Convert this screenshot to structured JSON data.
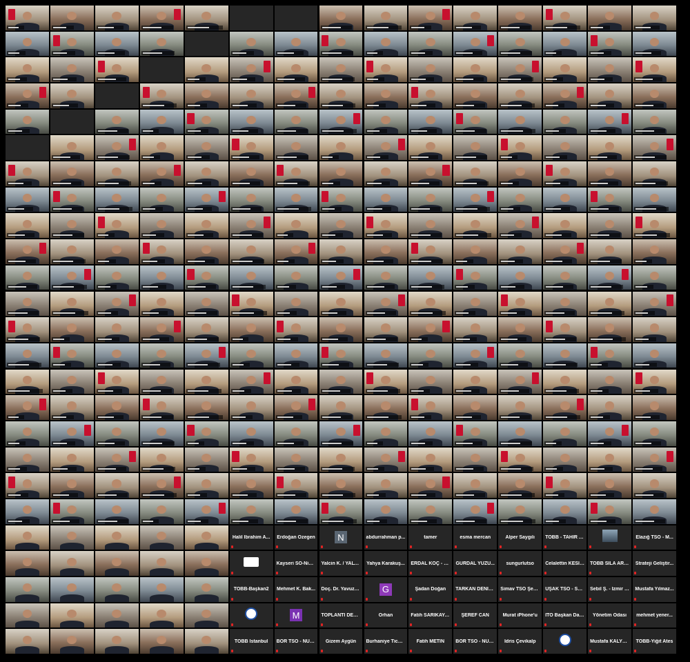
{
  "window": {
    "title": "",
    "background": "#000000",
    "tile_color": "#262626",
    "name_color": "#ffffff",
    "muted_color": "#e02424"
  },
  "gallery": {
    "columns": 15,
    "rows": 25,
    "video_rows": 20,
    "named_tiles": [
      {
        "row": 20,
        "col": 5,
        "label": "Halil İbrahim A...",
        "kind": "name"
      },
      {
        "row": 20,
        "col": 6,
        "label": "Erdoğan Özegen",
        "kind": "name"
      },
      {
        "row": 20,
        "col": 7,
        "label": "",
        "kind": "avatar",
        "initial": "N",
        "avatar": "n"
      },
      {
        "row": 20,
        "col": 8,
        "label": "abdurrahman p...",
        "kind": "name"
      },
      {
        "row": 20,
        "col": 9,
        "label": "tamer",
        "kind": "name"
      },
      {
        "row": 20,
        "col": 10,
        "label": "esma mercan",
        "kind": "name"
      },
      {
        "row": 20,
        "col": 11,
        "label": "Alper Saygılı",
        "kind": "name"
      },
      {
        "row": 20,
        "col": 12,
        "label": "TOBB - TAHİR A...",
        "kind": "name"
      },
      {
        "row": 20,
        "col": 13,
        "label": "",
        "kind": "photo"
      },
      {
        "row": 20,
        "col": 14,
        "label": "Elazığ TSO - M...",
        "kind": "name"
      },
      {
        "row": 21,
        "col": 5,
        "label": "",
        "kind": "logo-box"
      },
      {
        "row": 21,
        "col": 6,
        "label": "Kayseri SO-Niha...",
        "kind": "name"
      },
      {
        "row": 21,
        "col": 7,
        "label": "Yalcin K. / YALV...",
        "kind": "name"
      },
      {
        "row": 21,
        "col": 8,
        "label": "Yahya Karakuş...",
        "kind": "name"
      },
      {
        "row": 21,
        "col": 9,
        "label": "ERDAL KOÇ - M...",
        "kind": "name"
      },
      {
        "row": 21,
        "col": 10,
        "label": "GÜRDAL YÜZÜ...",
        "kind": "name"
      },
      {
        "row": 21,
        "col": 11,
        "label": "sungurlutso",
        "kind": "name"
      },
      {
        "row": 21,
        "col": 12,
        "label": "Celalettin KESİK...",
        "kind": "name"
      },
      {
        "row": 21,
        "col": 13,
        "label": "TOBB SILA ARDIÇ",
        "kind": "name"
      },
      {
        "row": 21,
        "col": 14,
        "label": "Strateji Geliştir...",
        "kind": "name"
      },
      {
        "row": 22,
        "col": 5,
        "label": "TOBB-Başkan2",
        "kind": "name"
      },
      {
        "row": 22,
        "col": 6,
        "label": "Mehmet K. Bak...",
        "kind": "name"
      },
      {
        "row": 22,
        "col": 7,
        "label": "Doç. Dr. Yavuz C...",
        "kind": "name"
      },
      {
        "row": 22,
        "col": 8,
        "label": "",
        "kind": "avatar",
        "initial": "G",
        "avatar": "g"
      },
      {
        "row": 22,
        "col": 9,
        "label": "Şadan Doğan",
        "kind": "name"
      },
      {
        "row": 22,
        "col": 10,
        "label": "TARKAN DENİZ...",
        "kind": "name"
      },
      {
        "row": 22,
        "col": 11,
        "label": "Simav TSO Şere...",
        "kind": "name"
      },
      {
        "row": 22,
        "col": 12,
        "label": "UŞAK TSO - Sell...",
        "kind": "name"
      },
      {
        "row": 22,
        "col": 13,
        "label": "Sebil Ş. - İzmir T...",
        "kind": "name"
      },
      {
        "row": 22,
        "col": 14,
        "label": "Mustafa Yılmaz...",
        "kind": "name"
      },
      {
        "row": 23,
        "col": 5,
        "label": "",
        "kind": "logo-circle"
      },
      {
        "row": 23,
        "col": 6,
        "label": "",
        "kind": "avatar",
        "initial": "M",
        "avatar": "m"
      },
      {
        "row": 23,
        "col": 7,
        "label": "TOPLANTI DEST...",
        "kind": "name"
      },
      {
        "row": 23,
        "col": 8,
        "label": "Orhan",
        "kind": "name"
      },
      {
        "row": 23,
        "col": 9,
        "label": "Fatih SARIKAYA...",
        "kind": "name"
      },
      {
        "row": 23,
        "col": 10,
        "label": "ŞEREF CAN",
        "kind": "name"
      },
      {
        "row": 23,
        "col": 11,
        "label": "Murat iPhone'u",
        "kind": "name"
      },
      {
        "row": 23,
        "col": 12,
        "label": "İTO Başkan Dan...",
        "kind": "name"
      },
      {
        "row": 23,
        "col": 13,
        "label": "Yönetim Odası",
        "kind": "name"
      },
      {
        "row": 23,
        "col": 14,
        "label": "mehmet yener...",
        "kind": "name"
      },
      {
        "row": 24,
        "col": 5,
        "label": "TOBB İstanbul",
        "kind": "name"
      },
      {
        "row": 24,
        "col": 6,
        "label": "BOR TSO - NURE...",
        "kind": "name"
      },
      {
        "row": 24,
        "col": 7,
        "label": "Gizem Aygün",
        "kind": "name"
      },
      {
        "row": 24,
        "col": 8,
        "label": "Burhaniye Ticar...",
        "kind": "name"
      },
      {
        "row": 24,
        "col": 9,
        "label": "Fatih METİN",
        "kind": "name"
      },
      {
        "row": 24,
        "col": 10,
        "label": "BOR TSO - NUR...",
        "kind": "name"
      },
      {
        "row": 24,
        "col": 11,
        "label": "İdris Çevikalp",
        "kind": "name"
      },
      {
        "row": 24,
        "col": 12,
        "label": "",
        "kind": "logo-circle"
      },
      {
        "row": 24,
        "col": 13,
        "label": "Mustafa KALYO...",
        "kind": "name"
      },
      {
        "row": 24,
        "col": 14,
        "label": "TOBB-Yiğit Ates",
        "kind": "name"
      }
    ]
  }
}
